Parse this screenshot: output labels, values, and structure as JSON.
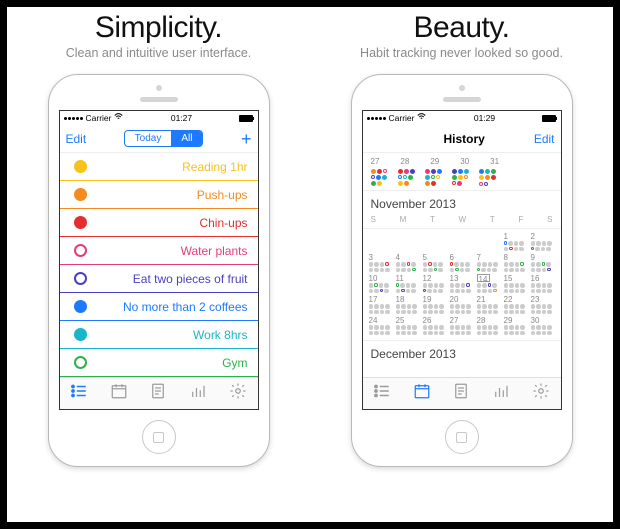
{
  "left": {
    "headline": "Simplicity.",
    "subhead": "Clean and intuitive user interface.",
    "status": {
      "carrier": "Carrier",
      "time": "01:27"
    },
    "nav": {
      "edit": "Edit",
      "seg_today": "Today",
      "seg_all": "All",
      "add": "+"
    },
    "habits": [
      {
        "label": "Reading 1hr",
        "color": "yellow",
        "ring": false
      },
      {
        "label": "Push-ups",
        "color": "orange",
        "ring": false
      },
      {
        "label": "Chin-ups",
        "color": "red",
        "ring": false
      },
      {
        "label": "Water plants",
        "color": "pink",
        "ring": true
      },
      {
        "label": "Eat two pieces of fruit",
        "color": "purple",
        "ring": true
      },
      {
        "label": "No more than 2 coffees",
        "color": "blue",
        "ring": false
      },
      {
        "label": "Work 8hrs",
        "color": "cyan",
        "ring": false
      },
      {
        "label": "Gym",
        "color": "green",
        "ring": true
      }
    ]
  },
  "right": {
    "headline": "Beauty.",
    "subhead": "Habit tracking never looked so good.",
    "status": {
      "carrier": "Carrier",
      "time": "01:29"
    },
    "nav": {
      "title": "History",
      "edit": "Edit"
    },
    "prev_tail_dates": [
      "27",
      "28",
      "29",
      "30",
      "31"
    ],
    "month1": "November 2013",
    "dow": [
      "S",
      "M",
      "T",
      "W",
      "T",
      "F",
      "S"
    ],
    "weeks": [
      [
        "",
        "",
        "",
        "",
        "",
        "1",
        "2"
      ],
      [
        "3",
        "4",
        "5",
        "6",
        "7",
        "8",
        "9"
      ],
      [
        "10",
        "11",
        "12",
        "13",
        "14",
        "15",
        "16"
      ],
      [
        "17",
        "18",
        "19",
        "20",
        "21",
        "22",
        "23"
      ],
      [
        "24",
        "25",
        "26",
        "27",
        "28",
        "29",
        "30"
      ]
    ],
    "today": "14",
    "month2": "December 2013"
  },
  "colors": {
    "accent": "#1d7aff"
  }
}
